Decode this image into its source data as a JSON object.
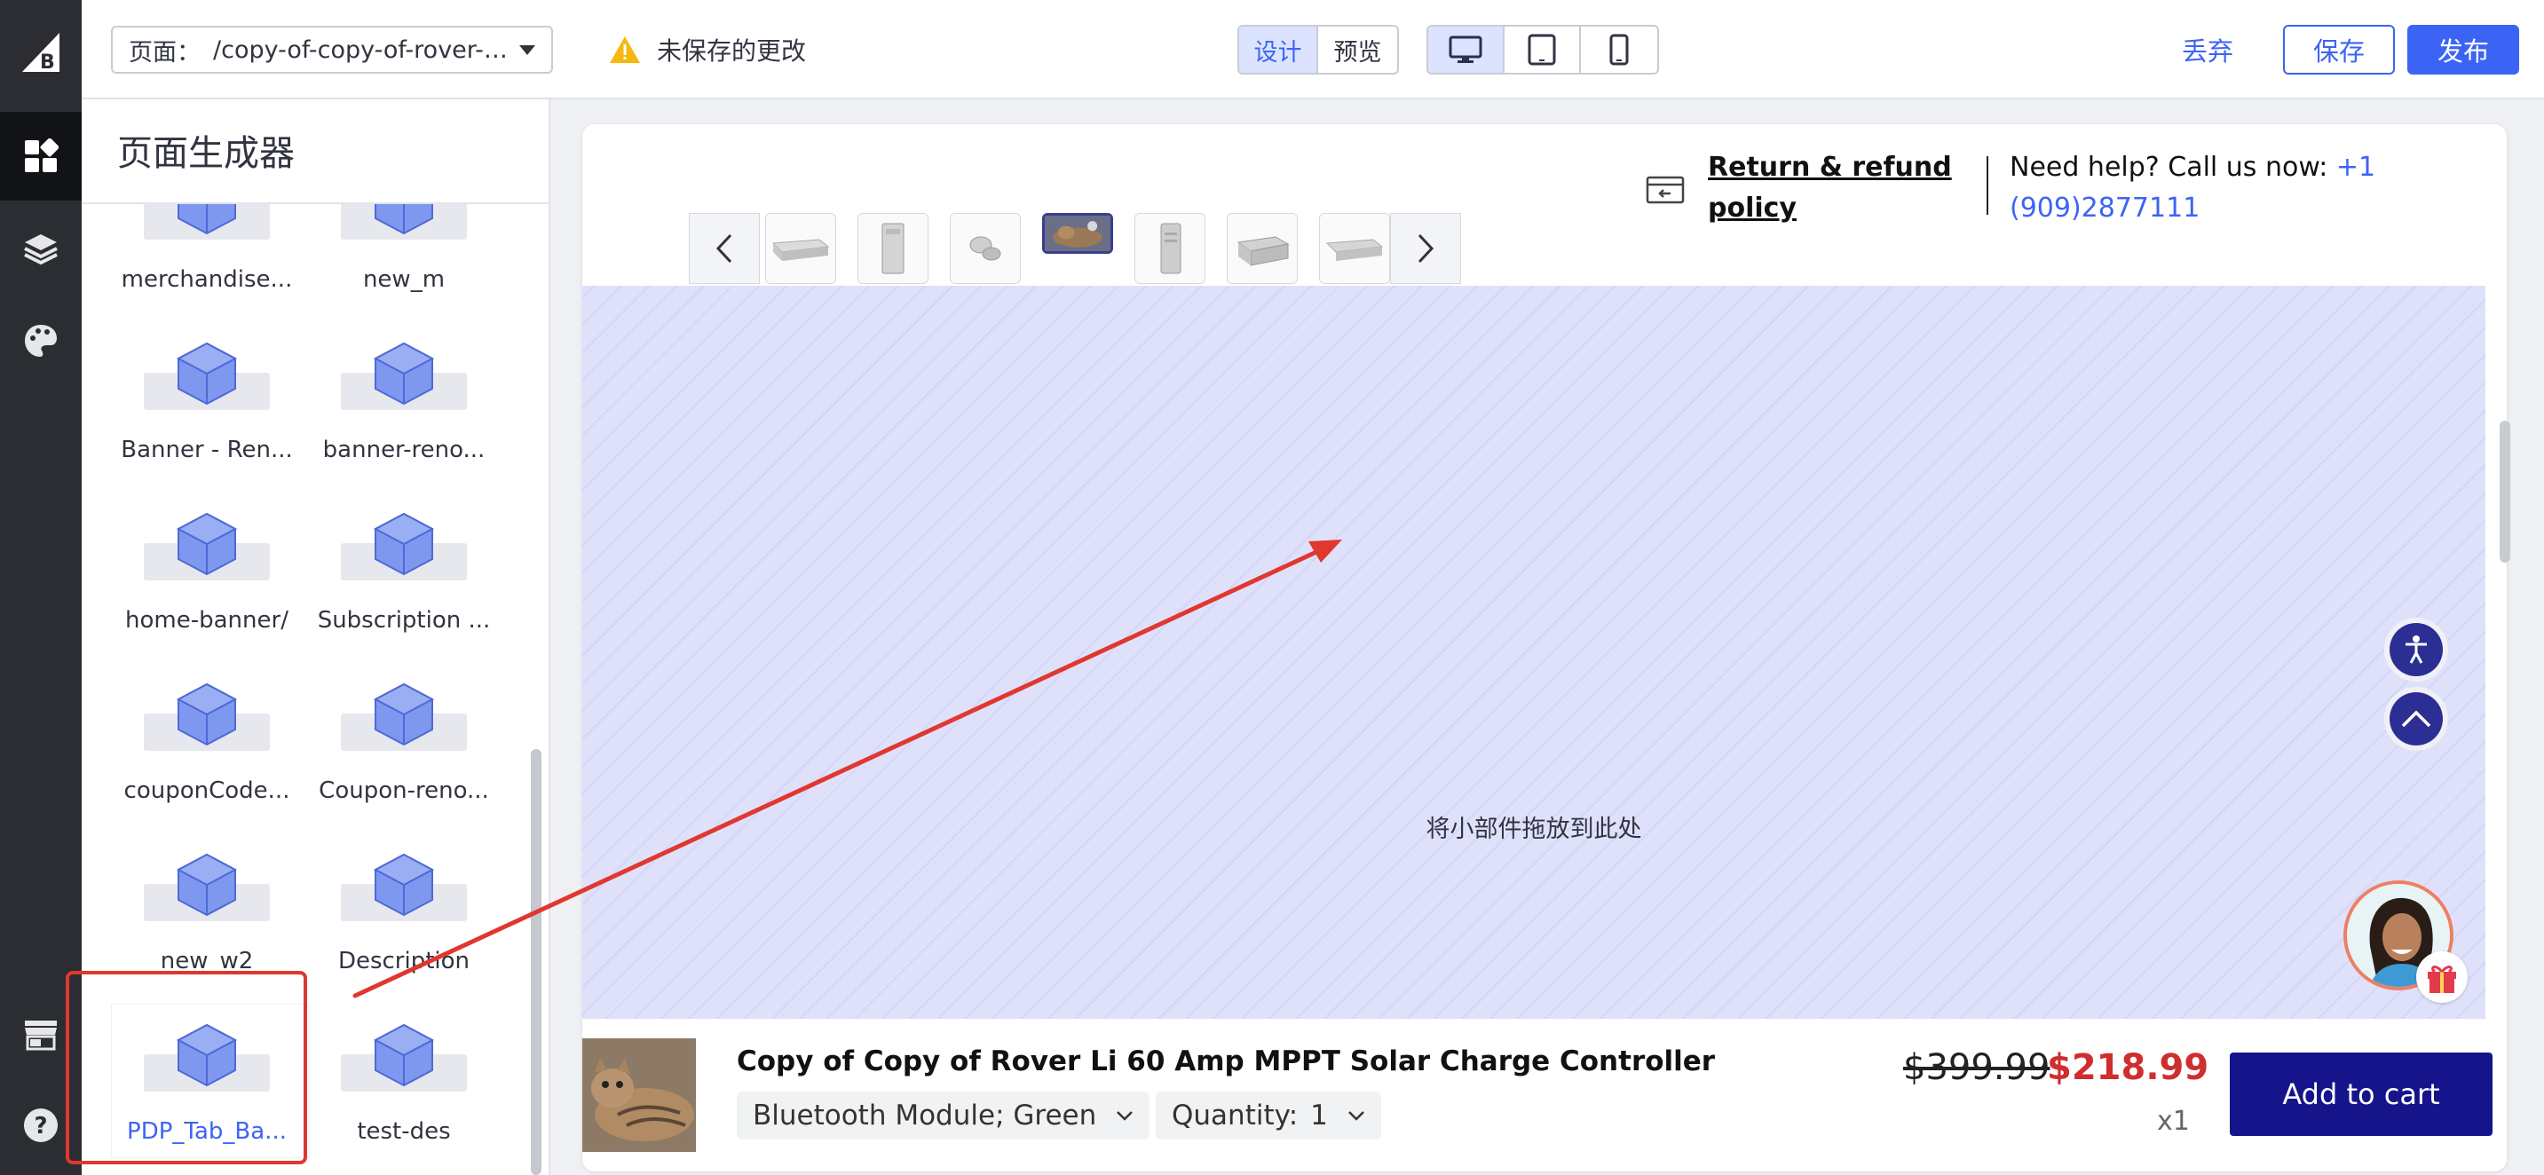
{
  "topbar": {
    "page_label": "页面：",
    "page_value": "/copy-of-copy-of-rover-li-...",
    "unsaved_text": "未保存的更改",
    "mode_tabs": [
      {
        "label": "设计",
        "active": true
      },
      {
        "label": "预览",
        "active": false
      }
    ],
    "device_icons": [
      "desktop-icon",
      "tablet-icon",
      "mobile-icon"
    ],
    "discard_label": "丢弃",
    "save_label": "保存",
    "publish_label": "发布"
  },
  "rail": {
    "icons": [
      "bigcommerce-logo",
      "widgets-icon",
      "layers-icon",
      "palette-icon",
      "storefront-icon",
      "help-icon"
    ],
    "active": "widgets-icon"
  },
  "panel": {
    "title": "页面生成器",
    "widgets": [
      "merchandise...",
      "new_m",
      "Banner - Ren...",
      "banner-reno...",
      "home-banner/",
      "Subscription ...",
      "couponCode...",
      "Coupon-reno...",
      "new_w2",
      "Description",
      "PDP_Tab_Ba...",
      "test-des"
    ],
    "selected": "PDP_Tab_Ba..."
  },
  "preview": {
    "refund_text": "Return & refund policy",
    "help_text": "Need help? Call us now: ",
    "help_phone": "+1 (909)2877111",
    "dropzone_text": "将小部件拖放到此处",
    "product": {
      "title": "Copy of Copy of Rover Li 60 Amp MPPT Solar Charge Controller",
      "variant": "Bluetooth Module; Green",
      "quantity_label": "Quantity:",
      "quantity_value": "1",
      "old_price": "$399.99",
      "new_price": "$218.99",
      "qty_multiplier": "x1",
      "add_to_cart": "Add to cart"
    }
  },
  "colors": {
    "accent": "#3c64f4",
    "dropzone": "#dfe1fb",
    "sale_price": "#cf2e2e",
    "cart_button": "#15148a",
    "annotation": "#e0372f"
  }
}
